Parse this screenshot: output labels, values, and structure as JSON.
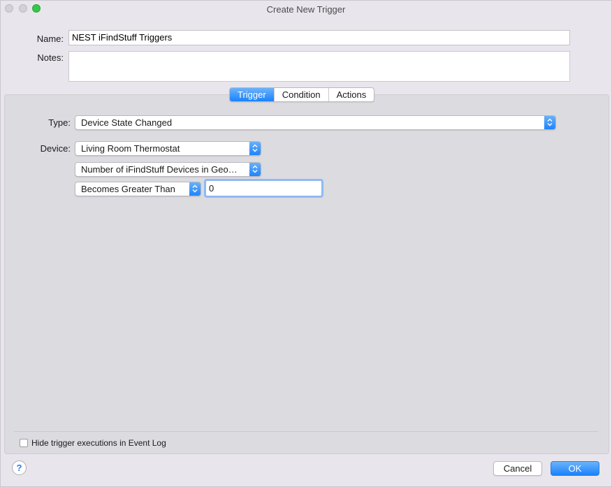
{
  "window": {
    "title": "Create New Trigger"
  },
  "form": {
    "name_label": "Name:",
    "name_value": "NEST iFindStuff Triggers",
    "notes_label": "Notes:",
    "notes_value": ""
  },
  "tabs": [
    {
      "label": "Trigger",
      "active": true
    },
    {
      "label": "Condition",
      "active": false
    },
    {
      "label": "Actions",
      "active": false
    }
  ],
  "trigger": {
    "type_label": "Type:",
    "type_value": "Device State Changed",
    "device_label": "Device:",
    "device_value": "Living Room Thermostat",
    "state_value": "Number of iFindStuff Devices in Geo…",
    "comparison_value": "Becomes Greater Than",
    "threshold_value": "0"
  },
  "footer": {
    "hide_checkbox_label": "Hide trigger executions in Event Log",
    "hide_checkbox_checked": false,
    "help_label": "?",
    "cancel_label": "Cancel",
    "ok_label": "OK"
  },
  "colors": {
    "accent": "#1a82fb",
    "window_bg": "#e8e6ec",
    "panel_bg": "#dcdbe0"
  }
}
